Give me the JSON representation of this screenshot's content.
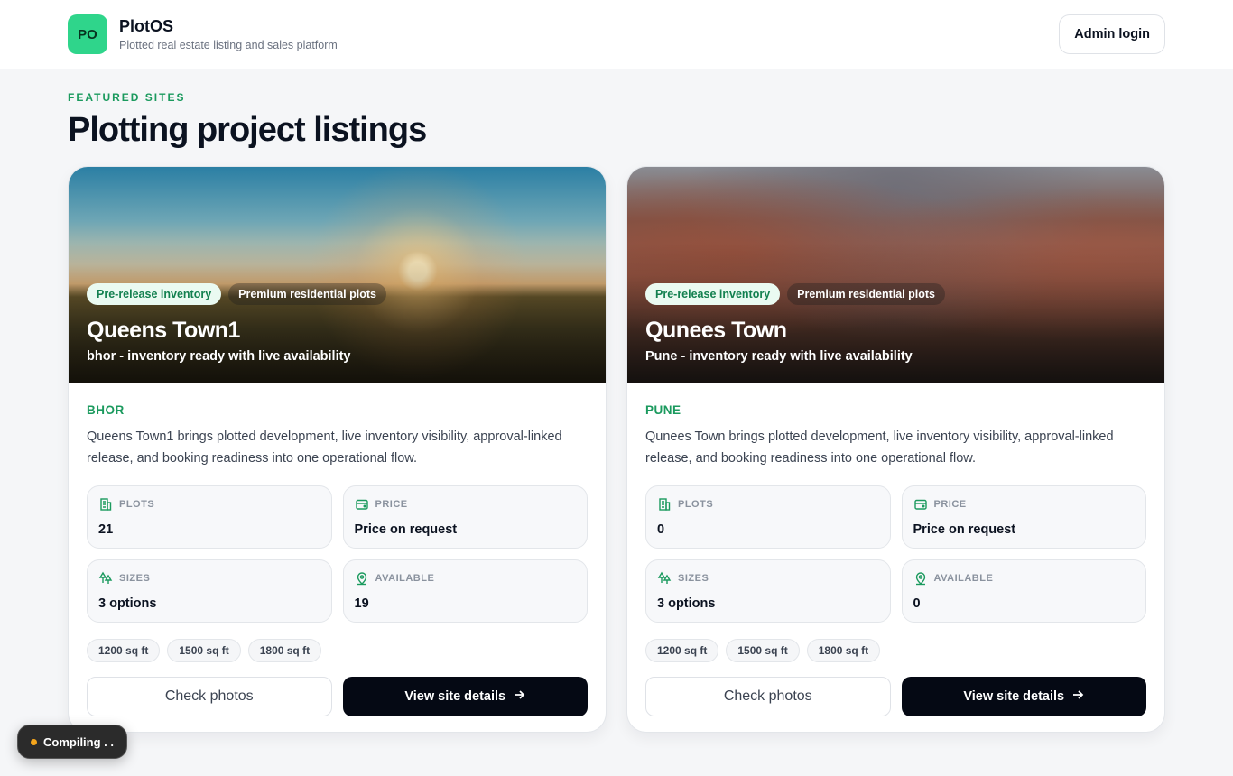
{
  "brand": {
    "logo_text": "PO",
    "name": "PlotOS",
    "tagline": "Plotted real estate listing and sales platform"
  },
  "header": {
    "admin_login": "Admin login"
  },
  "section": {
    "eyebrow": "FEATURED SITES",
    "title": "Plotting project listings"
  },
  "listings": [
    {
      "chip_status": "Pre-release inventory",
      "chip_type": "Premium residential plots",
      "title": "Queens Town1",
      "subtitle": "bhor - inventory ready with live availability",
      "city": "BHOR",
      "description": "Queens Town1 brings plotted development, live inventory visibility, approval-linked release, and booking readiness into one operational flow.",
      "stats": {
        "plots_label": "PLOTS",
        "plots_value": "21",
        "price_label": "PRICE",
        "price_value": "Price on request",
        "sizes_label": "SIZES",
        "sizes_value": "3 options",
        "available_label": "AVAILABLE",
        "available_value": "19"
      },
      "sizes": [
        "1200 sq ft",
        "1500 sq ft",
        "1800 sq ft"
      ],
      "check_photos": "Check photos",
      "view_details": "View site details"
    },
    {
      "chip_status": "Pre-release inventory",
      "chip_type": "Premium residential plots",
      "title": "Qunees Town",
      "subtitle": "Pune - inventory ready with live availability",
      "city": "PUNE",
      "description": "Qunees Town brings plotted development, live inventory visibility, approval-linked release, and booking readiness into one operational flow.",
      "stats": {
        "plots_label": "PLOTS",
        "plots_value": "0",
        "price_label": "PRICE",
        "price_value": "Price on request",
        "sizes_label": "SIZES",
        "sizes_value": "3 options",
        "available_label": "AVAILABLE",
        "available_value": "0"
      },
      "sizes": [
        "1200 sq ft",
        "1500 sq ft",
        "1800 sq ft"
      ],
      "check_photos": "Check photos",
      "view_details": "View site details"
    }
  ],
  "status_toast": "Compiling . .",
  "colors": {
    "accent": "#1b9a5e",
    "logo_bg": "#2fd58b",
    "dark_button": "#050914",
    "status_dot": "#f4a51c"
  }
}
